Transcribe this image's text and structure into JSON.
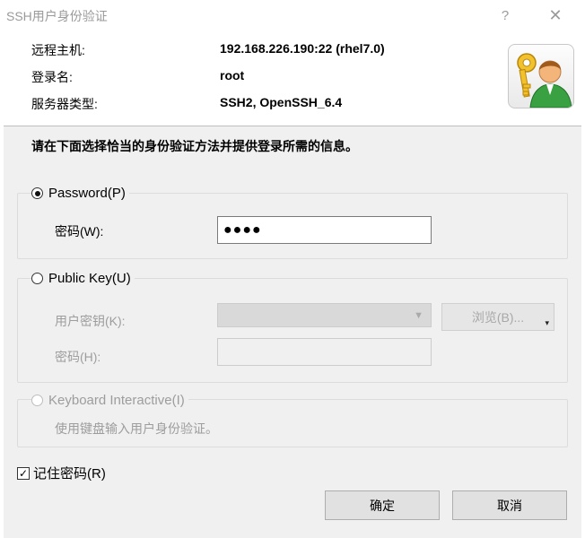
{
  "window": {
    "title": "SSH用户身份验证",
    "help_label": "?",
    "close_label": "✕"
  },
  "info": {
    "host_label": "远程主机:",
    "host_value": "192.168.226.190:22 (rhel7.0)",
    "login_label": "登录名:",
    "login_value": "root",
    "server_type_label": "服务器类型:",
    "server_type_value": "SSH2, OpenSSH_6.4"
  },
  "instruction": "请在下面选择恰当的身份验证方法并提供登录所需的信息。",
  "password_method": {
    "label": "Password(P)",
    "selected": true,
    "password_label": "密码(W):",
    "password_value": "●●●●"
  },
  "publickey_method": {
    "label": "Public Key(U)",
    "selected": false,
    "user_key_label": "用户密钥(K):",
    "user_key_value": "",
    "browse_label": "浏览(B)...",
    "passphrase_label": "密码(H):",
    "passphrase_value": ""
  },
  "keyboard_method": {
    "label": "Keyboard Interactive(I)",
    "selected": false,
    "description": "使用键盘输入用户身份验证。"
  },
  "remember_password": {
    "label": "记住密码(R)",
    "checked": true,
    "check_glyph": "✓"
  },
  "buttons": {
    "ok": "确定",
    "cancel": "取消"
  },
  "colors": {
    "dialog_bg": "#f0f0f0",
    "disabled_text": "#9d9d9d",
    "button_bg": "#e1e1e1"
  },
  "icons": {
    "avatar": "user-with-key-icon",
    "dropdown": "chevron-down-icon"
  }
}
